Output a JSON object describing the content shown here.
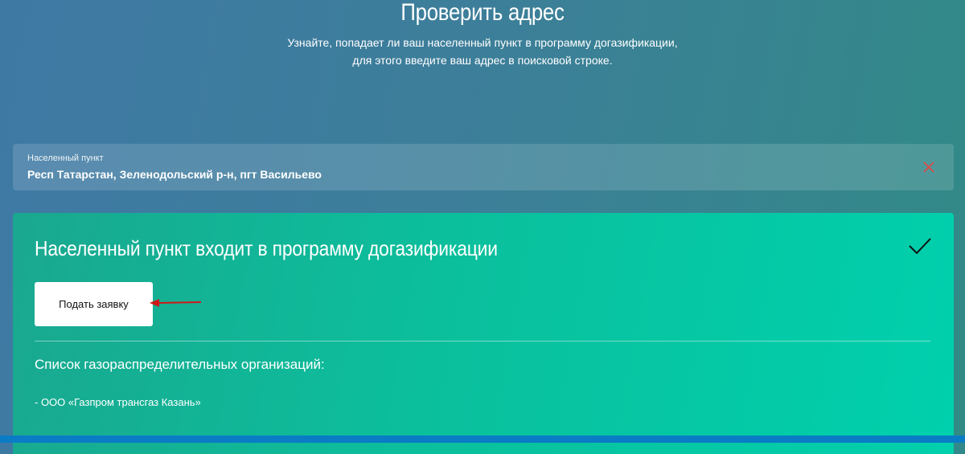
{
  "header": {
    "title": "Проверить адрес",
    "subtitle_line1": "Узнайте, попадает ли ваш населенный пункт в программу догазификации,",
    "subtitle_line2": "для этого введите ваш адрес в поисковой строке."
  },
  "search": {
    "label": "Населенный пункт",
    "value": "Респ Татарстан, Зеленодольский р-н, пгт Васильево",
    "clear_icon": "close-icon"
  },
  "result": {
    "title": "Населенный пункт входит в программу догазификации",
    "status_icon": "check-icon",
    "apply_button_label": "Подать заявку",
    "orgs_heading": "Список газораспределительных организаций:",
    "orgs": [
      "- ООО «Газпром трансгаз Казань»"
    ]
  },
  "colors": {
    "accent_clear": "#e04848",
    "annotation_arrow": "#d01818",
    "card_start": "#1aa890",
    "card_end": "#00d0ad",
    "bottom_bar": "#0a7cc5"
  }
}
